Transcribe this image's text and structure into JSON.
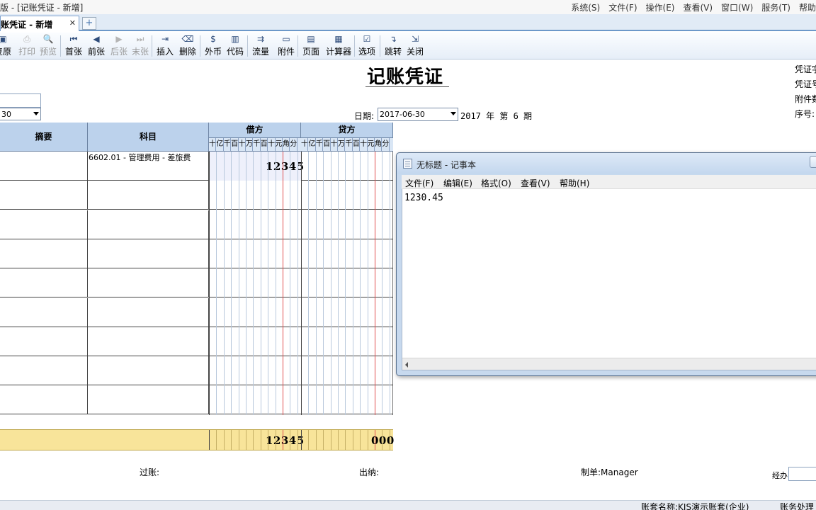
{
  "window": {
    "title": "版 - [记账凭证 - 新增]",
    "menu": [
      "系统(S)",
      "文件(F)",
      "操作(E)",
      "查看(V)",
      "窗口(W)",
      "服务(T)",
      "帮助"
    ]
  },
  "tab": {
    "label": "账凭证 - 新增",
    "close": "✕",
    "new": "+"
  },
  "toolbar": {
    "buttons": [
      {
        "label": "复原",
        "icon": "restore-icon",
        "glyph": "▣",
        "disabled": false
      },
      {
        "label": "打印",
        "icon": "print-icon",
        "glyph": "⎙",
        "disabled": true
      },
      {
        "label": "预览",
        "icon": "preview-icon",
        "glyph": "🔍",
        "disabled": true
      },
      {
        "label": "首张",
        "icon": "first-icon",
        "glyph": "⏮",
        "disabled": false
      },
      {
        "label": "前张",
        "icon": "prev-icon",
        "glyph": "◀",
        "disabled": false
      },
      {
        "label": "后张",
        "icon": "next-icon",
        "glyph": "▶",
        "disabled": true
      },
      {
        "label": "末张",
        "icon": "last-icon",
        "glyph": "⏭",
        "disabled": true
      },
      {
        "label": "插入",
        "icon": "insert-icon",
        "glyph": "⇥",
        "disabled": false
      },
      {
        "label": "删除",
        "icon": "delete-icon",
        "glyph": "⌫",
        "disabled": false
      },
      {
        "label": "外币",
        "icon": "currency-icon",
        "glyph": "$",
        "disabled": false
      },
      {
        "label": "代码",
        "icon": "code-icon",
        "glyph": "▥",
        "disabled": false
      },
      {
        "label": "流量",
        "icon": "flow-icon",
        "glyph": "⇉",
        "disabled": false
      },
      {
        "label": "附件",
        "icon": "attachment-icon",
        "glyph": "▭",
        "disabled": false
      },
      {
        "label": "页面",
        "icon": "page-icon",
        "glyph": "▤",
        "disabled": false
      },
      {
        "label": "计算器",
        "icon": "calculator-icon",
        "glyph": "▦",
        "disabled": false
      },
      {
        "label": "选项",
        "icon": "options-icon",
        "glyph": "☑",
        "disabled": false
      },
      {
        "label": "跳转",
        "icon": "jump-icon",
        "glyph": "↴",
        "disabled": false
      },
      {
        "label": "关闭",
        "icon": "close-doc-icon",
        "glyph": "⇲",
        "disabled": false
      }
    ]
  },
  "voucher": {
    "title": "记账凭证",
    "right_labels": [
      "凭证字",
      "凭证号",
      "附件数",
      "序号:"
    ],
    "left_date": "30",
    "date_label": "日期:",
    "date_value": "2017-06-30",
    "period_text": "2017 年 第 6 期"
  },
  "grid": {
    "headers": {
      "summary": "摘要",
      "account": "科目",
      "debit": "借方",
      "credit": "贷方"
    },
    "digit_labels": [
      "十",
      "亿",
      "千",
      "百",
      "十",
      "万",
      "千",
      "百",
      "十",
      "元",
      "角",
      "分"
    ],
    "rows": [
      {
        "account": "6602.01 - 管理费用 - 差旅费",
        "debit": "12345"
      },
      {
        "account": "",
        "debit": ""
      },
      {
        "account": "",
        "debit": ""
      },
      {
        "account": "",
        "debit": ""
      },
      {
        "account": "",
        "debit": ""
      },
      {
        "account": "",
        "debit": ""
      },
      {
        "account": "",
        "debit": ""
      },
      {
        "account": "",
        "debit": ""
      },
      {
        "account": "",
        "debit": ""
      }
    ],
    "totals": {
      "debit": "12345",
      "credit": "000"
    }
  },
  "footer": {
    "posted": "过账:",
    "cashier": "出纳:",
    "maker": "制单:Manager",
    "handler": "经办:"
  },
  "statusbar": {
    "account_set": "账套名称:KIS演示账套(企业)",
    "module": "账务处理"
  },
  "notepad": {
    "title": "无标题 - 记事本",
    "menu": [
      "文件(F)",
      "编辑(E)",
      "格式(O)",
      "查看(V)",
      "帮助(H)"
    ],
    "content": "1230.45"
  }
}
